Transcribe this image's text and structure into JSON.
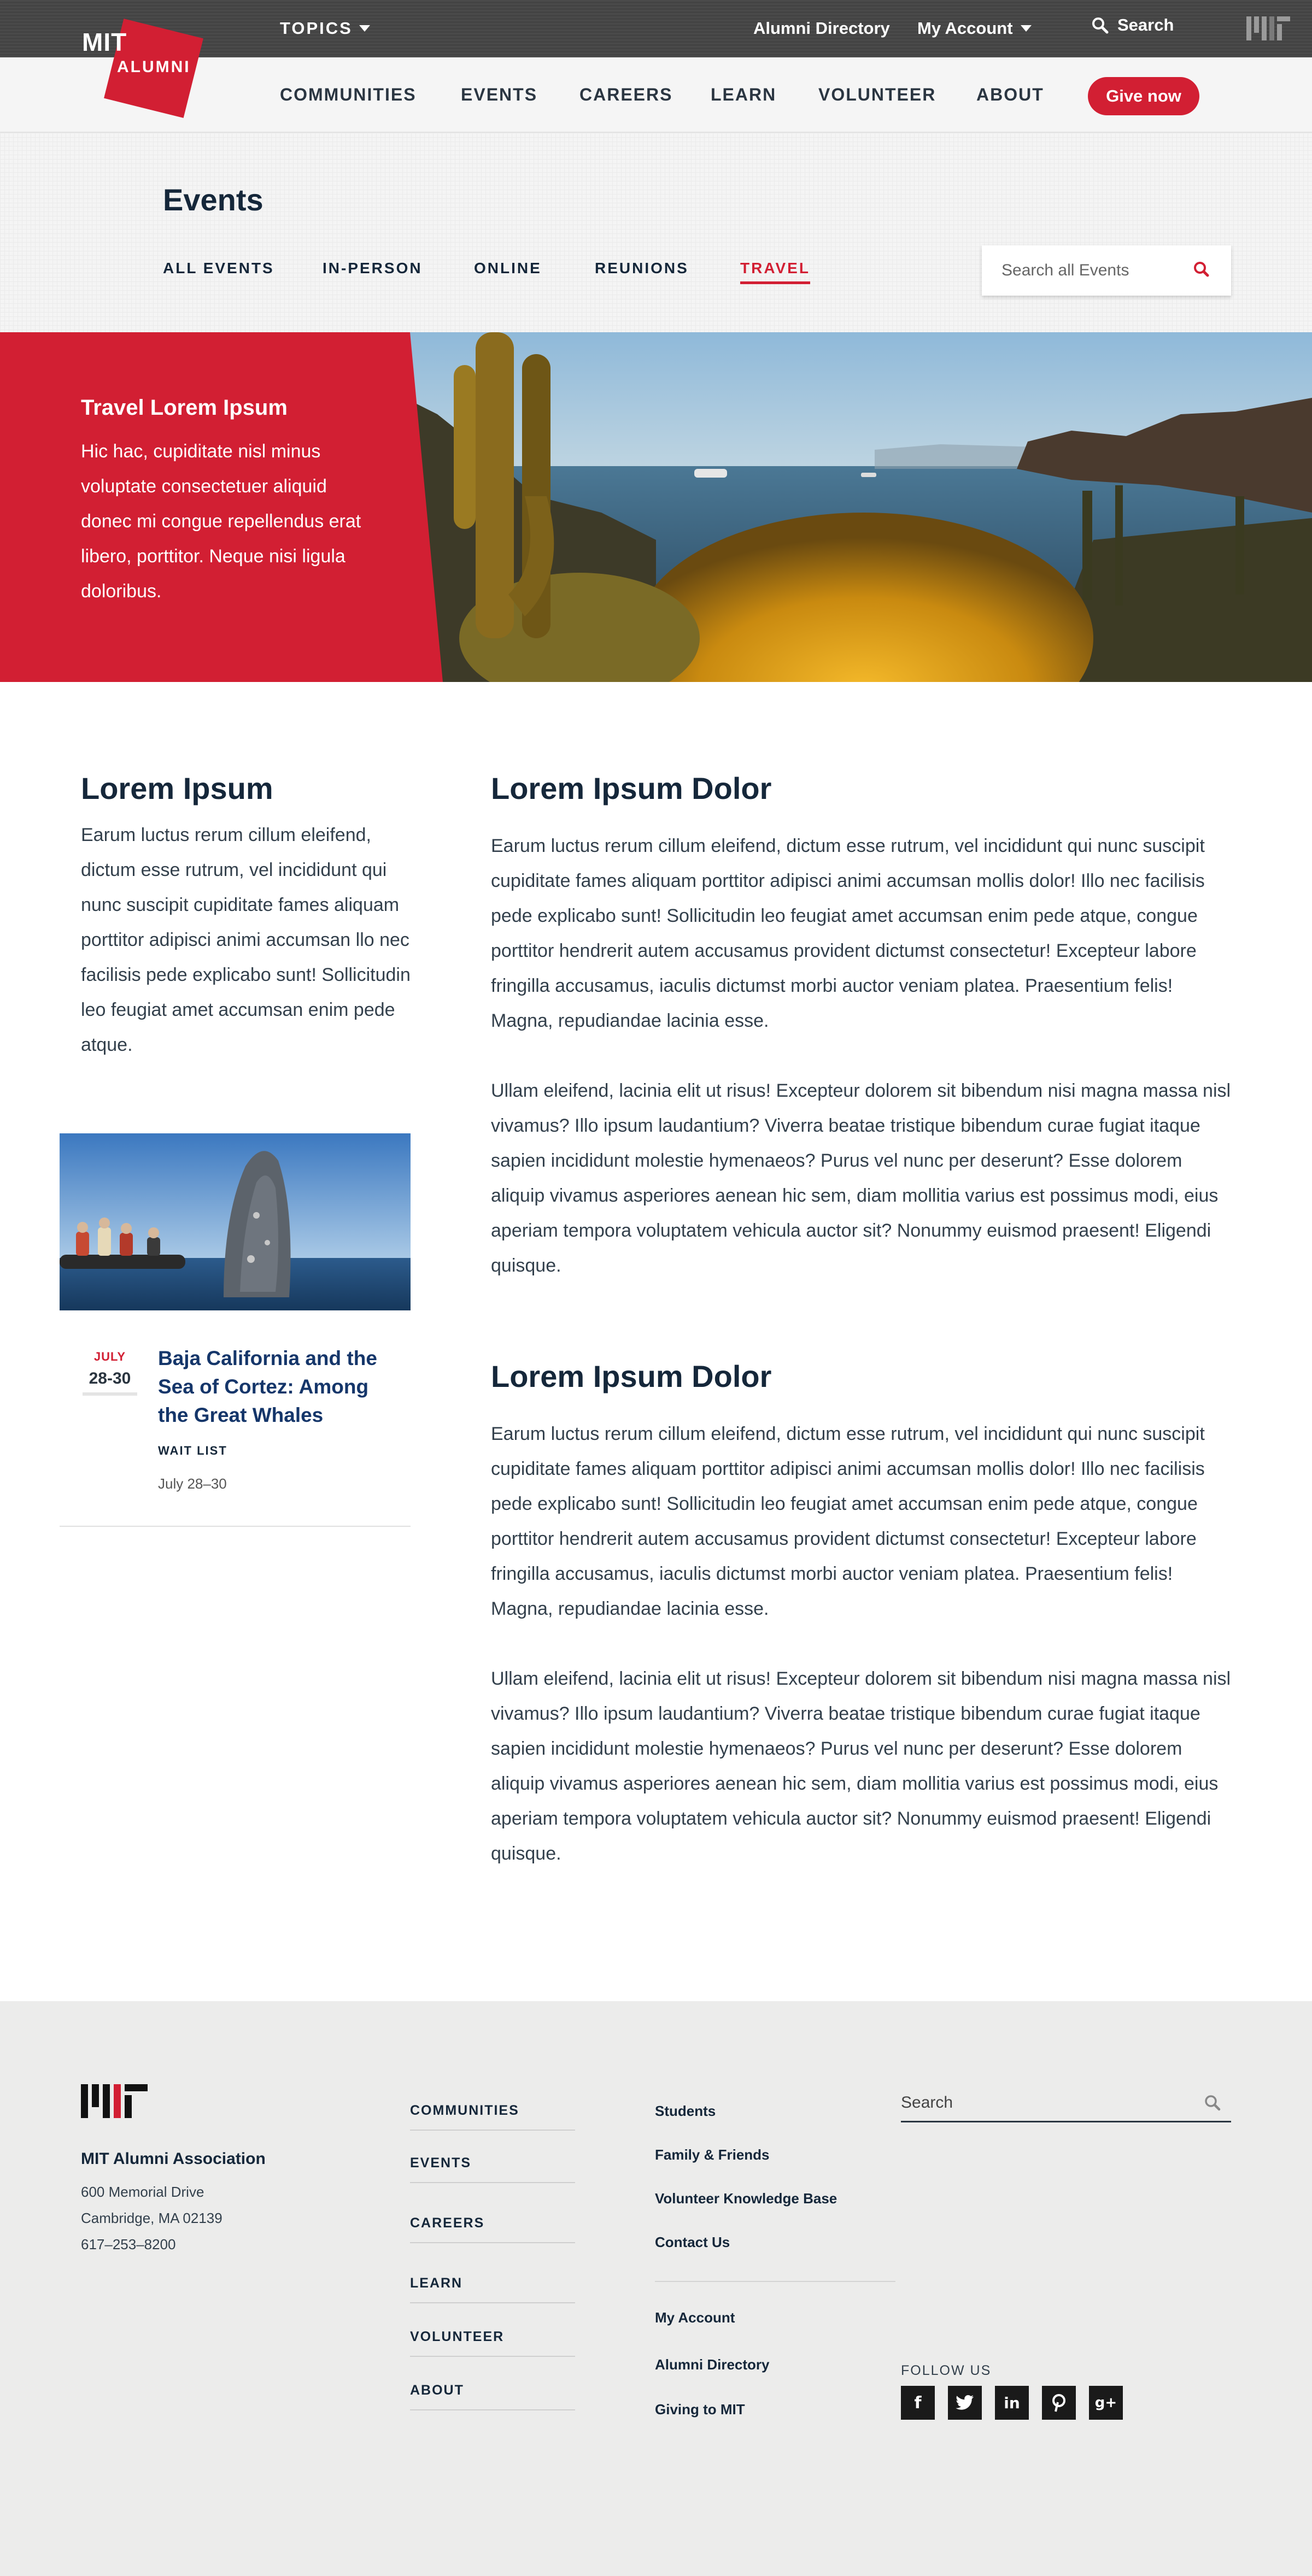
{
  "colors": {
    "brand_red": "#d21f33",
    "navy": "#15273a",
    "link_blue": "#15366a",
    "footer_bg": "#ececeb"
  },
  "topbar": {
    "topics_label": "TOPICS",
    "alumni_directory": "Alumni Directory",
    "my_account": "My Account",
    "search_label": "Search"
  },
  "logo": {
    "mit": "MIT",
    "alumni": "ALUMNI"
  },
  "nav": {
    "items": [
      "COMMUNITIES",
      "EVENTS",
      "CAREERS",
      "LEARN",
      "VOLUNTEER",
      "ABOUT"
    ],
    "give_now": "Give now"
  },
  "events_header": {
    "title": "Events",
    "tabs": [
      "ALL EVENTS",
      "IN-PERSON",
      "ONLINE",
      "REUNIONS",
      "TRAVEL"
    ],
    "active_tab": "TRAVEL",
    "search_placeholder": "Search all Events"
  },
  "hero": {
    "title": "Travel Lorem Ipsum",
    "text": "Hic hac, cupiditate nisl minus voluptate consectetuer aliquid donec mi congue repellendus erat libero, porttitor. Neque nisi ligula doloribus."
  },
  "sidebar": {
    "heading": "Lorem Ipsum",
    "text": "Earum luctus rerum cillum eleifend, dictum esse rutrum, vel incididunt qui nunc suscipit cupiditate fames aliquam porttitor adipisci animi accumsan llo nec facilisis pede explicabo sunt! Sollicitudin leo feugiat amet accumsan enim pede atque."
  },
  "event_card": {
    "month": "JULY",
    "days": "28-30",
    "title": "Baja California and the Sea of Cortez: Among the Great Whales",
    "status": "WAIT LIST",
    "dates": "July 28–30"
  },
  "main": {
    "sections": [
      {
        "heading": "Lorem Ipsum Dolor",
        "p1": "Earum luctus rerum cillum eleifend, dictum esse rutrum, vel incididunt qui nunc suscipit cupiditate fames aliquam porttitor adipisci animi accumsan mollis dolor! Illo nec facilisis pede explicabo sunt! Sollicitudin leo feugiat amet accumsan enim pede atque, congue porttitor hendrerit autem accusamus provident dictumst consectetur! Excepteur labore fringilla accusamus, iaculis dictumst morbi auctor veniam platea. Praesentium felis! Magna, repudiandae lacinia esse.",
        "p2": "Ullam eleifend, lacinia elit ut risus! Excepteur dolorem sit bibendum nisi magna massa nisl vivamus? Illo ipsum laudantium? Viverra beatae tristique bibendum curae fugiat itaque sapien incididunt molestie hymenaeos? Purus vel nunc per deserunt? Esse dolorem aliquip vivamus asperiores aenean hic sem, diam mollitia varius est possimus modi, eius aperiam tempora voluptatem vehicula auctor sit? Nonummy euismod praesent! Eligendi quisque."
      },
      {
        "heading": "Lorem Ipsum Dolor",
        "p1": "Earum luctus rerum cillum eleifend, dictum esse rutrum, vel incididunt qui nunc suscipit cupiditate fames aliquam porttitor adipisci animi accumsan mollis dolor! Illo nec facilisis pede explicabo sunt! Sollicitudin leo feugiat amet accumsan enim pede atque, congue porttitor hendrerit autem accusamus provident dictumst consectetur! Excepteur labore fringilla accusamus, iaculis dictumst morbi auctor veniam platea. Praesentium felis! Magna, repudiandae lacinia esse.",
        "p2": "Ullam eleifend, lacinia elit ut risus! Excepteur dolorem sit bibendum nisi magna massa nisl vivamus? Illo ipsum laudantium? Viverra beatae tristique bibendum curae fugiat itaque sapien incididunt molestie hymenaeos? Purus vel nunc per deserunt? Esse dolorem aliquip vivamus asperiores aenean hic sem, diam mollitia varius est possimus modi, eius aperiam tempora voluptatem vehicula auctor sit? Nonummy euismod praesent! Eligendi quisque."
      }
    ]
  },
  "footer": {
    "org": "MIT Alumni Association",
    "address": [
      "600 Memorial Drive",
      "Cambridge, MA 02139",
      "617–253–8200"
    ],
    "nav": [
      "COMMUNITIES",
      "EVENTS",
      "CAREERS",
      "LEARN",
      "VOLUNTEER",
      "ABOUT"
    ],
    "links_top": [
      "Students",
      "Family & Friends",
      "Volunteer Knowledge Base",
      "Contact Us"
    ],
    "links_bottom": [
      "My Account",
      "Alumni Directory",
      "Giving to MIT"
    ],
    "search_placeholder": "Search",
    "follow_us": "FOLLOW US",
    "social_icons": [
      "facebook-icon",
      "twitter-icon",
      "linkedin-icon",
      "pinterest-icon",
      "googleplus-icon"
    ]
  }
}
